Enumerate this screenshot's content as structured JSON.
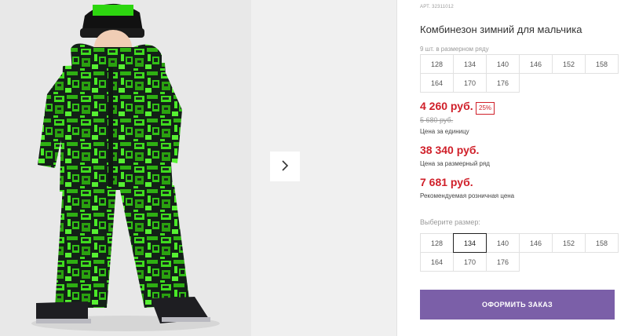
{
  "product": {
    "article": "АРТ. 32311012",
    "title": "Комбинезон зимний для мальчика"
  },
  "pack": {
    "label": "9 шт. в размерном ряду",
    "sizes": [
      "128",
      "134",
      "140",
      "146",
      "152",
      "158",
      "164",
      "170",
      "176"
    ]
  },
  "prices": {
    "unit_price": "4 260 руб.",
    "discount": "25%",
    "old_price": "5 680 руб.",
    "unit_note": "Цена за единицу",
    "pack_price": "38 340 руб.",
    "pack_note": "Цена за размерный ряд",
    "retail_price": "7 681 руб.",
    "retail_note": "Рекомендуемая розничная цена"
  },
  "size_select": {
    "label": "Выберите размер:",
    "sizes": [
      "128",
      "134",
      "140",
      "146",
      "152",
      "158",
      "164",
      "170",
      "176"
    ],
    "selected": "134"
  },
  "actions": {
    "order_label": "ОФОРМИТЬ ЗАКАЗ"
  },
  "colors": {
    "accent": "#7b5fa8",
    "price_red": "#d0202a",
    "print_green": "#3fdc1f"
  },
  "icons": {
    "next": "chevron-right-icon"
  }
}
